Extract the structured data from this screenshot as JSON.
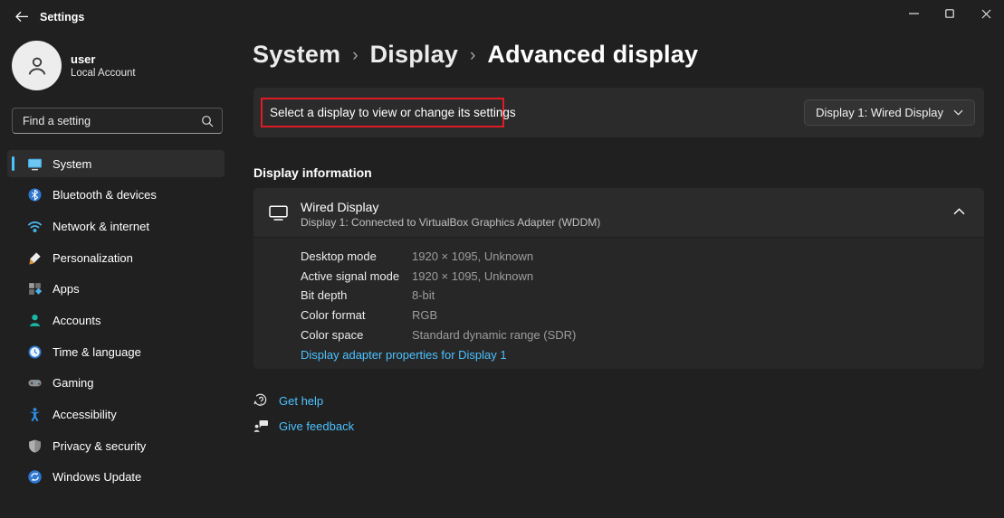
{
  "titlebar": {
    "app_title": "Settings"
  },
  "user": {
    "name": "user",
    "account_type": "Local Account"
  },
  "search": {
    "placeholder": "Find a setting"
  },
  "sidebar": {
    "items": [
      {
        "label": "System",
        "icon": "system-icon",
        "selected": true
      },
      {
        "label": "Bluetooth & devices",
        "icon": "bluetooth-icon",
        "selected": false
      },
      {
        "label": "Network & internet",
        "icon": "network-icon",
        "selected": false
      },
      {
        "label": "Personalization",
        "icon": "personalization-icon",
        "selected": false
      },
      {
        "label": "Apps",
        "icon": "apps-icon",
        "selected": false
      },
      {
        "label": "Accounts",
        "icon": "accounts-icon",
        "selected": false
      },
      {
        "label": "Time & language",
        "icon": "time-language-icon",
        "selected": false
      },
      {
        "label": "Gaming",
        "icon": "gaming-icon",
        "selected": false
      },
      {
        "label": "Accessibility",
        "icon": "accessibility-icon",
        "selected": false
      },
      {
        "label": "Privacy & security",
        "icon": "privacy-icon",
        "selected": false
      },
      {
        "label": "Windows Update",
        "icon": "windows-update-icon",
        "selected": false
      }
    ]
  },
  "breadcrumb": {
    "items": [
      "System",
      "Display",
      "Advanced display"
    ],
    "separator": "›"
  },
  "select_display": {
    "label": "Select a display to view or change its settings",
    "dropdown_value": "Display 1: Wired Display",
    "annotation_color": "#e01b24"
  },
  "display_information": {
    "section_title": "Display information",
    "card_title": "Wired Display",
    "card_subtitle": "Display 1: Connected to VirtualBox Graphics Adapter (WDDM)",
    "rows": [
      {
        "label": "Desktop mode",
        "value": "1920 × 1095, Unknown"
      },
      {
        "label": "Active signal mode",
        "value": "1920 × 1095, Unknown"
      },
      {
        "label": "Bit depth",
        "value": "8-bit"
      },
      {
        "label": "Color format",
        "value": "RGB"
      },
      {
        "label": "Color space",
        "value": "Standard dynamic range (SDR)"
      }
    ],
    "adapter_link": "Display adapter properties for Display 1"
  },
  "footer_links": {
    "help": "Get help",
    "feedback": "Give feedback"
  },
  "colors": {
    "background": "#202020",
    "card": "#2b2b2b",
    "card_body": "#272727",
    "accent": "#4cc2ff",
    "link": "#4cc2ff",
    "annotation_red": "#e01b24",
    "secondary_text": "#9d9d9d"
  }
}
